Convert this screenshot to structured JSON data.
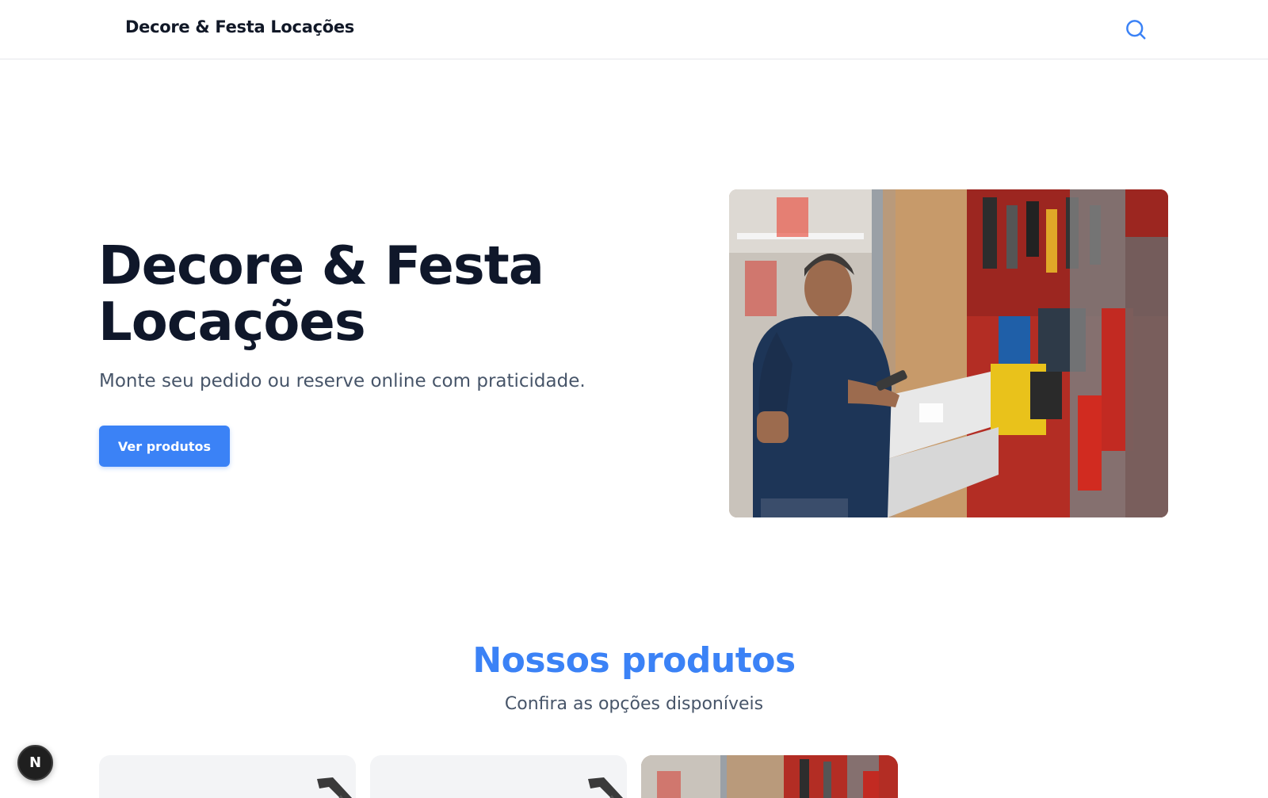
{
  "header": {
    "brand": "Decore & Festa Locações",
    "search_icon": "search-icon"
  },
  "hero": {
    "title": "Decore & Festa Locações",
    "subtitle": "Monte seu pedido ou reserve online com praticidade.",
    "cta_label": "Ver produtos"
  },
  "products": {
    "title": "Nossos produtos",
    "subtitle": "Confira as opções disponíveis"
  },
  "dev_badge": {
    "label": "N"
  },
  "colors": {
    "accent": "#3b82f6",
    "heading": "#0f172a",
    "muted": "#475569",
    "border": "#e5e7eb"
  }
}
